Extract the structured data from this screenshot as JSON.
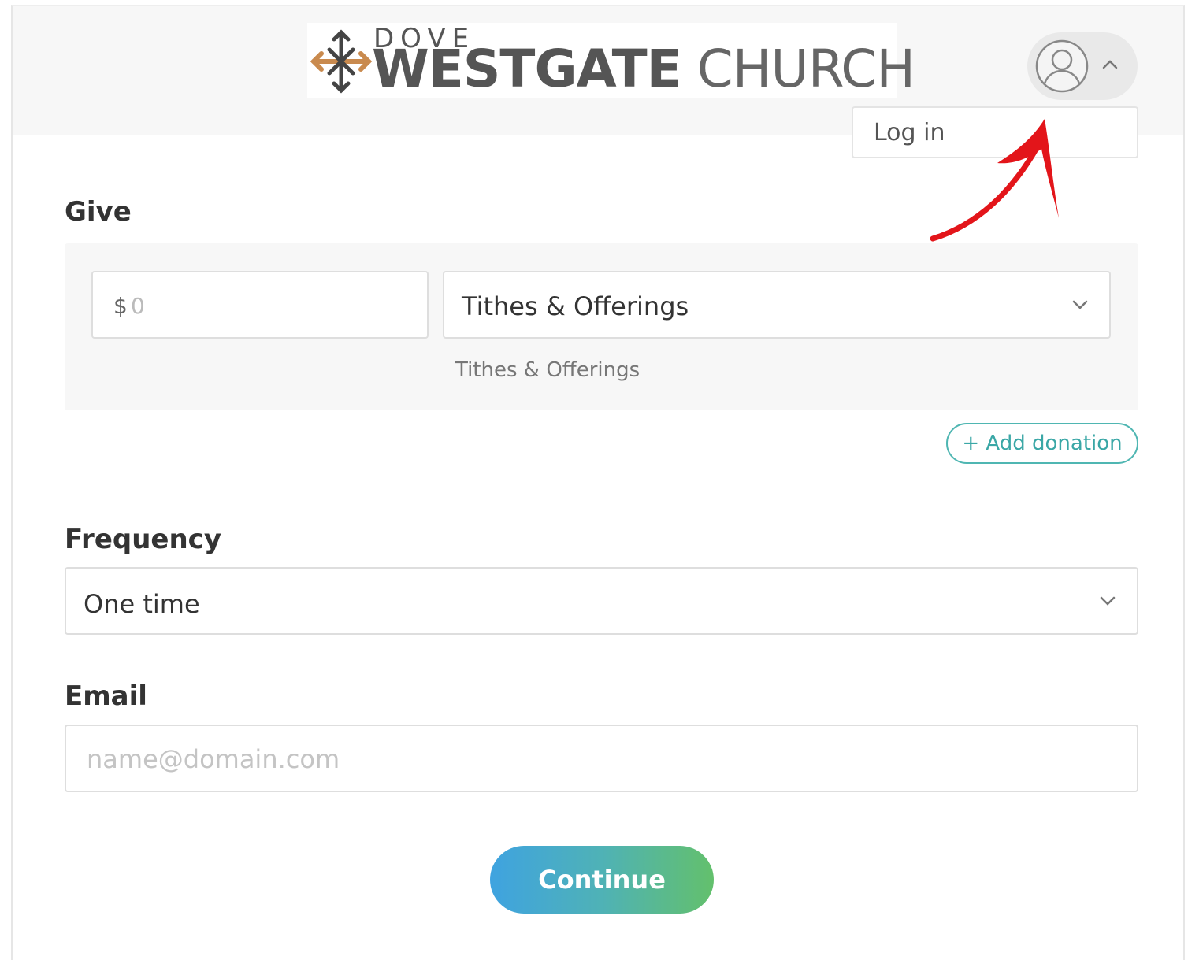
{
  "header": {
    "logo": {
      "top_text": "DOVE",
      "name_bold": "WESTGATE",
      "name_light": "CHURCH"
    },
    "user_menu": {
      "items": [
        {
          "label": "Log in"
        }
      ]
    }
  },
  "give": {
    "title": "Give",
    "amount": {
      "currency": "$",
      "placeholder": "0"
    },
    "fund": {
      "selected": "Tithes & Offerings",
      "caption": "Tithes & Offerings"
    },
    "add_donation_label": "+ Add donation"
  },
  "frequency": {
    "title": "Frequency",
    "selected": "One time"
  },
  "email": {
    "title": "Email",
    "placeholder": "name@domain.com"
  },
  "actions": {
    "continue_label": "Continue"
  },
  "colors": {
    "accent_teal": "#4fb6b2",
    "gradient_start": "#3fa3e0",
    "gradient_end": "#63c06c",
    "annotation_arrow": "#e3151a",
    "logo_mark": "#c98a4e"
  }
}
